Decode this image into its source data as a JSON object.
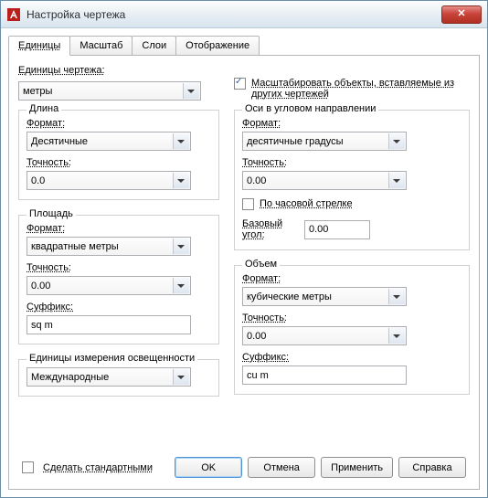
{
  "window": {
    "title": "Настройка чертежа"
  },
  "tabs": {
    "units": "Единицы",
    "scale": "Масштаб",
    "layers": "Слои",
    "display": "Отображение"
  },
  "drawing_units": {
    "label": "Единицы чертежа:",
    "value": "метры"
  },
  "scale_on_insert": {
    "label_line1": "Масштабировать объекты, вставляемые из",
    "label_line2": "других чертежей",
    "checked": true
  },
  "length": {
    "legend": "Длина",
    "format_label": "Формат:",
    "format_value": "Десятичные",
    "precision_label": "Точность:",
    "precision_value": "0.0"
  },
  "angular": {
    "legend": "Оси в угловом направлении",
    "format_label": "Формат:",
    "format_value": "десятичные градусы",
    "precision_label": "Точность:",
    "precision_value": "0.00",
    "clockwise_label": "По часовой стрелке",
    "clockwise_checked": false,
    "base_label": "Базовый угол:",
    "base_value": "0.00"
  },
  "area": {
    "legend": "Площадь",
    "format_label": "Формат:",
    "format_value": "квадратные метры",
    "precision_label": "Точность:",
    "precision_value": "0.00",
    "suffix_label": "Суффикс:",
    "suffix_value": "sq m"
  },
  "volume": {
    "legend": "Объем",
    "format_label": "Формат:",
    "format_value": "кубические метры",
    "precision_label": "Точность:",
    "precision_value": "0.00",
    "suffix_label": "Суффикс:",
    "suffix_value": "cu m"
  },
  "lighting": {
    "legend": "Единицы измерения освещенности",
    "value": "Международные"
  },
  "footer": {
    "make_default_label": "Сделать стандартными",
    "make_default_checked": false,
    "ok": "OK",
    "cancel": "Отмена",
    "apply": "Применить",
    "help": "Справка"
  }
}
